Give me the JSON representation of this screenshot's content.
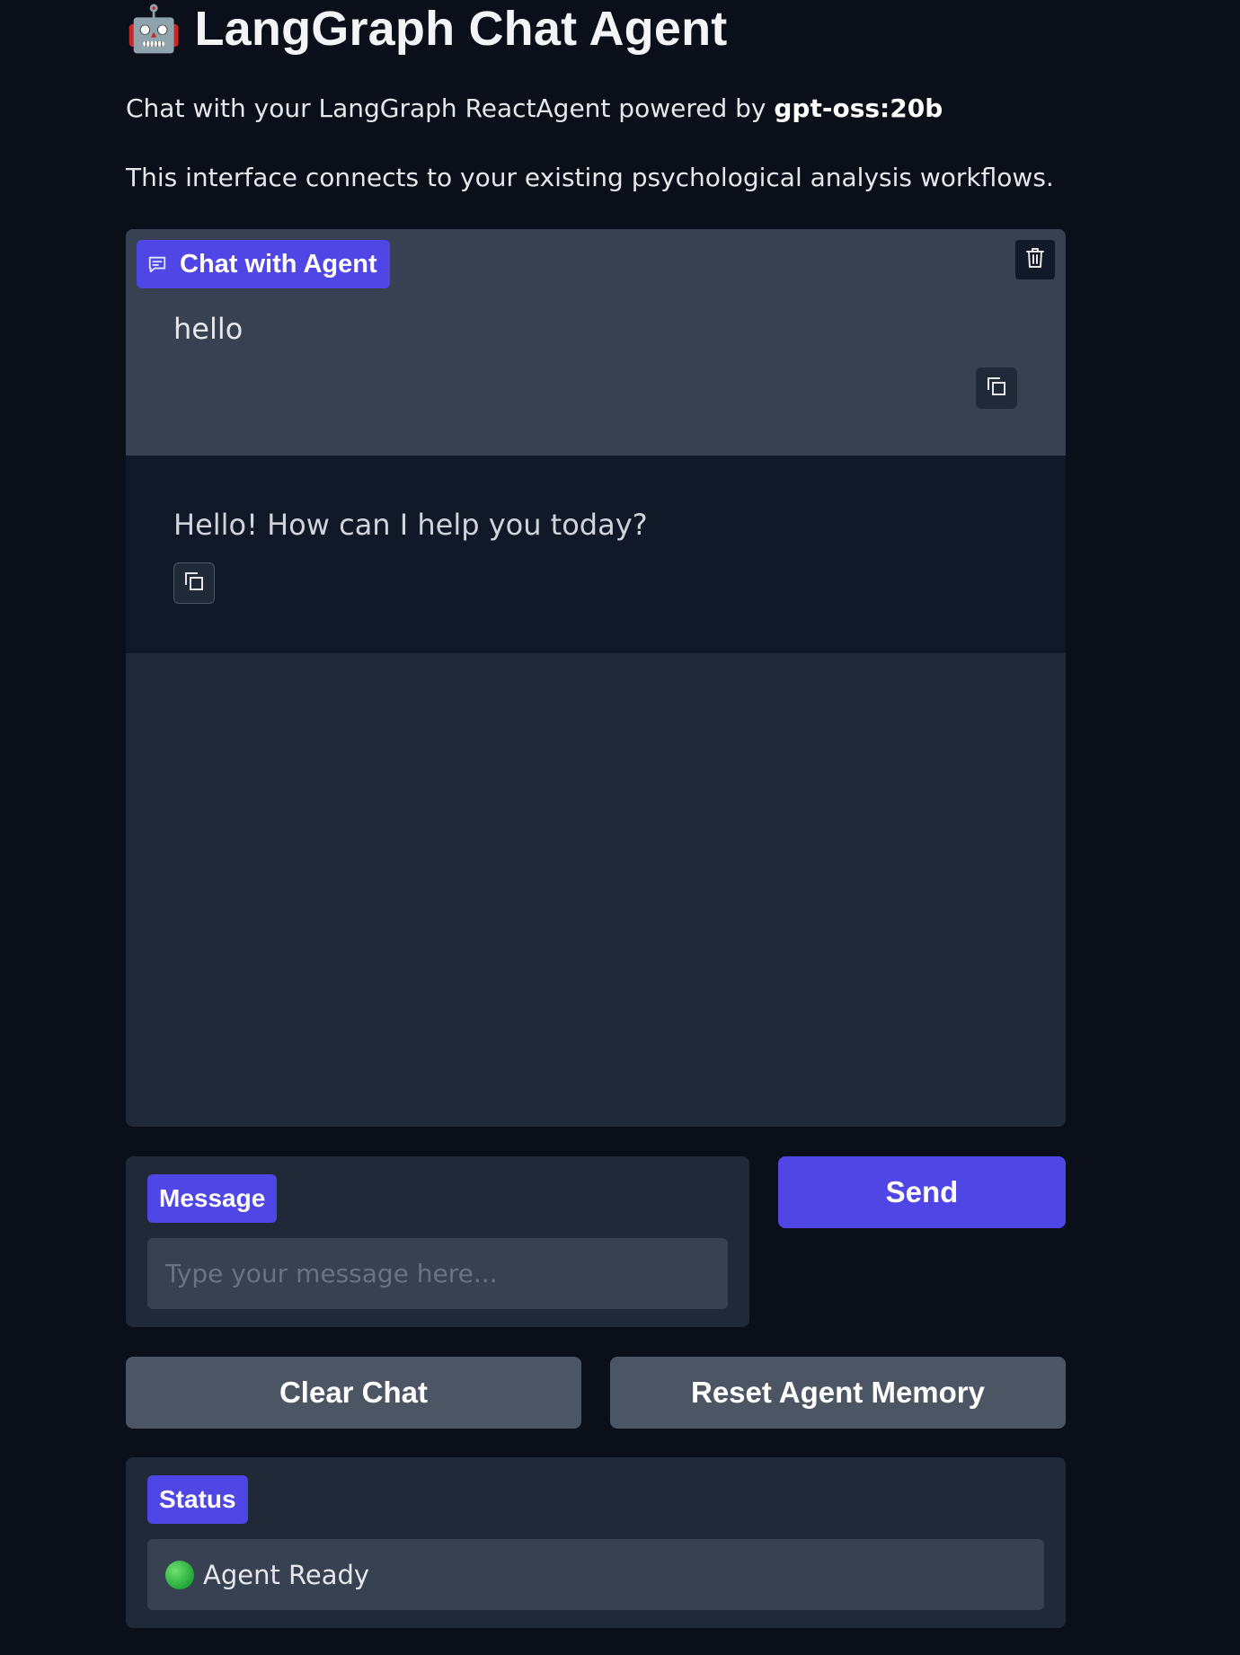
{
  "header": {
    "emoji": "🤖",
    "title": "LangGraph Chat Agent"
  },
  "description": {
    "line1_prefix": "Chat with your LangGraph ReactAgent powered by ",
    "model": "gpt-oss:20b",
    "line2": "This interface connects to your existing psychological analysis workflows."
  },
  "chat": {
    "label": "Chat with Agent",
    "messages": [
      {
        "role": "user",
        "text": "hello"
      },
      {
        "role": "assistant",
        "text": "Hello! How can I help you today?"
      }
    ]
  },
  "input": {
    "label": "Message",
    "placeholder": "Type your message here...",
    "value": ""
  },
  "buttons": {
    "send": "Send",
    "clear": "Clear Chat",
    "reset": "Reset Agent Memory"
  },
  "status": {
    "label": "Status",
    "value": "Agent Ready"
  },
  "colors": {
    "background": "#0b0f19",
    "panel": "#1f2937",
    "accent": "#4f46e5",
    "secondary_button": "#4b5563",
    "status_ok": "#22a83a"
  }
}
